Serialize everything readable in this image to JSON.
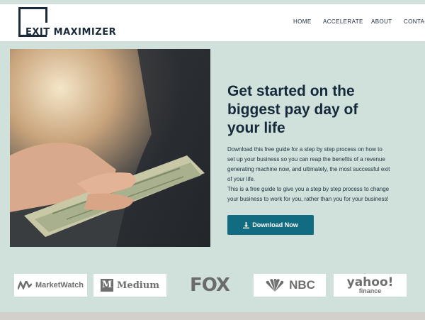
{
  "brand": {
    "logo_text": "EXIT MAXIMIZER"
  },
  "nav": {
    "items": [
      "HOME",
      "ACCELERATE",
      "ABOUT",
      "CONTACT"
    ]
  },
  "hero": {
    "image_alt": "Hand holding out cash",
    "headline": "Get started on the biggest pay day of your life",
    "paragraph_1": "Download this free guide for a step by step process on how to set up your business so you can reap the benefits of a revenue generating machine now, and ultimately, the most successful exit of your life.",
    "paragraph_2": "This is a free guide to give you a step by step process to change your business to work for you, rather than you for your business!",
    "download_button": "Download Now",
    "download_icon": "download-icon"
  },
  "press_logos": [
    {
      "label": "MarketWatch",
      "icon": "marketwatch-icon"
    },
    {
      "label": "Medium",
      "icon": "medium-icon"
    },
    {
      "label": "FOX",
      "icon": ""
    },
    {
      "label": "NBC",
      "icon": "nbc-peacock-icon"
    },
    {
      "label": "yahoo!",
      "sub": "finance",
      "icon": ""
    }
  ],
  "colors": {
    "background": "#cfe1da",
    "header_bg": "#ffffff",
    "headline": "#15293a",
    "button_bg": "#116c82",
    "footer_strip": "#d3cfcb"
  }
}
